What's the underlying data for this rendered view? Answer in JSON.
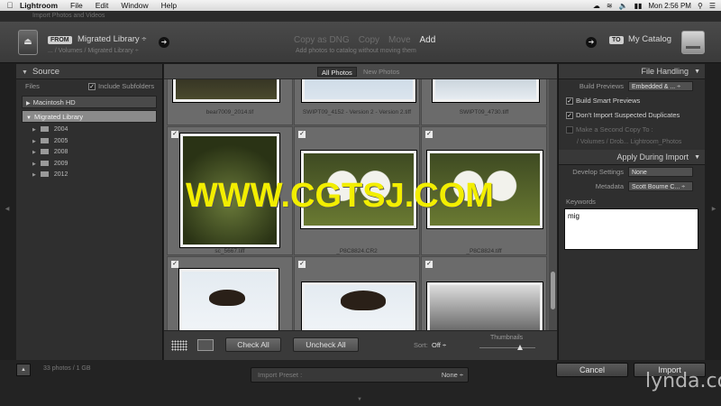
{
  "menubar": {
    "items": [
      "Lightroom",
      "File",
      "Edit",
      "Window",
      "Help"
    ],
    "clock": "Mon 2:56 PM"
  },
  "window_title": "Import Photos and Videos",
  "header": {
    "from_badge": "FROM",
    "source_name": "Migrated Library ÷",
    "source_path": "... / Volumes / Migrated Library ÷",
    "modes": [
      "Copy as DNG",
      "Copy",
      "Move",
      "Add"
    ],
    "active_mode": "Add",
    "mode_description": "Add photos to catalog without moving them",
    "to_badge": "TO",
    "destination_name": "My Catalog"
  },
  "source_panel": {
    "title": "Source",
    "files_label": "Files",
    "include_subfolders": "Include Subfolders",
    "volumes": [
      "Macintosh HD",
      "Migrated Library"
    ],
    "folders": [
      "2004",
      "2005",
      "2008",
      "2009",
      "2012"
    ]
  },
  "center": {
    "tabs": [
      "All Photos",
      "New Photos"
    ],
    "grid_files": [
      "bear7009_2014.tif",
      "SWIPT09_4152 - Version 2 - Version 2.tiff",
      "SWIPT09_4730.tiff",
      "sc_5667.tiff",
      "_P8C8824.CR2",
      "_P8C8824.tiff"
    ],
    "check_all": "Check All",
    "uncheck_all": "Uncheck All",
    "sort_label": "Sort:",
    "sort_value": "Off ÷",
    "thumbnails_label": "Thumbnails"
  },
  "file_handling": {
    "title": "File Handling",
    "build_previews_label": "Build Previews",
    "build_previews_value": "Embedded & ... ÷",
    "build_smart_previews": "Build Smart Previews",
    "dont_import_duplicates": "Don't Import Suspected Duplicates",
    "second_copy": "Make a Second Copy To :",
    "second_copy_path": "/ Volumes / Drob... Lightroom_Photos"
  },
  "apply_during_import": {
    "title": "Apply During Import",
    "develop_settings_label": "Develop Settings",
    "develop_settings_value": "None",
    "metadata_label": "Metadata",
    "metadata_value": "Scott Bourne C... ÷",
    "keywords_label": "Keywords",
    "keywords_value": "mig"
  },
  "bottom": {
    "photo_count": "33 photos / 1 GB",
    "import_preset_label": "Import Preset :",
    "import_preset_value": "None ÷",
    "cancel": "Cancel",
    "import": "Import"
  },
  "watermark": "WWW.CGTSJ.COM",
  "lynda": "lynda.com"
}
